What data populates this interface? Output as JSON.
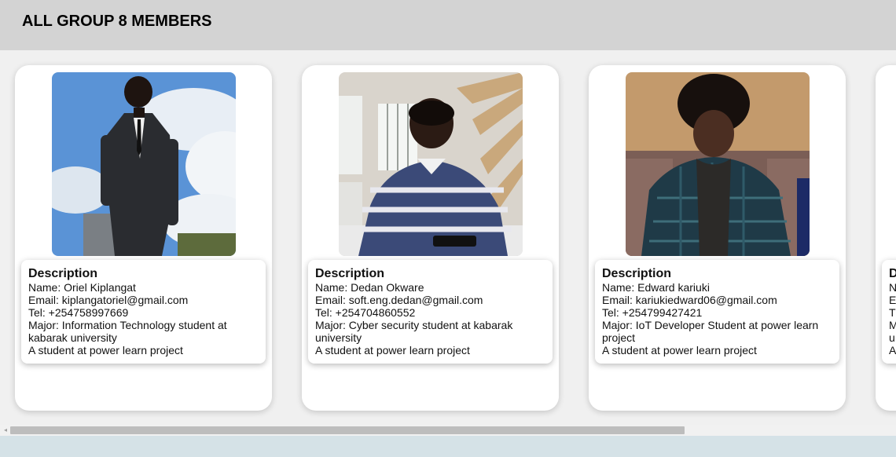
{
  "header": {
    "title": "ALL GROUP 8 MEMBERS"
  },
  "members": [
    {
      "photo_icon": "person-photo-suit-sky",
      "desc_title": "Description",
      "name": "Name: Oriel Kiplangat",
      "email": "Email: kiplangatoriel@gmail.com",
      "tel": "Tel: +254758997669",
      "major": "Major: Information Technology student at kabarak university",
      "note": "A student at power learn project"
    },
    {
      "photo_icon": "person-photo-striped-sweater",
      "desc_title": "Description",
      "name": "Name: Dedan Okware",
      "email": "Email: soft.eng.dedan@gmail.com",
      "tel": "Tel: +254704860552",
      "major": "Major: Cyber security student at kabarak university",
      "note": "A student at power learn project"
    },
    {
      "photo_icon": "person-photo-plaid-jacket",
      "desc_title": "Description",
      "name": "Name: Edward kariuki",
      "email": "Email: kariukiedward06@gmail.com",
      "tel": "Tel: +254799427421",
      "major": "Major: IoT Developer Student at power learn project",
      "note": "A student at power learn project"
    },
    {
      "desc_title": "D",
      "name": "N",
      "email": "E",
      "tel": "T",
      "major": "M",
      "major2": "u",
      "note": "A"
    }
  ],
  "scrollbar": {
    "left_arrow": "◂"
  },
  "colors": {
    "header_bg": "#d3d3d3",
    "strip_bg": "#f0f0f0",
    "footer_bg": "#d5e2e7",
    "scroll_thumb": "#bdbdbd"
  }
}
